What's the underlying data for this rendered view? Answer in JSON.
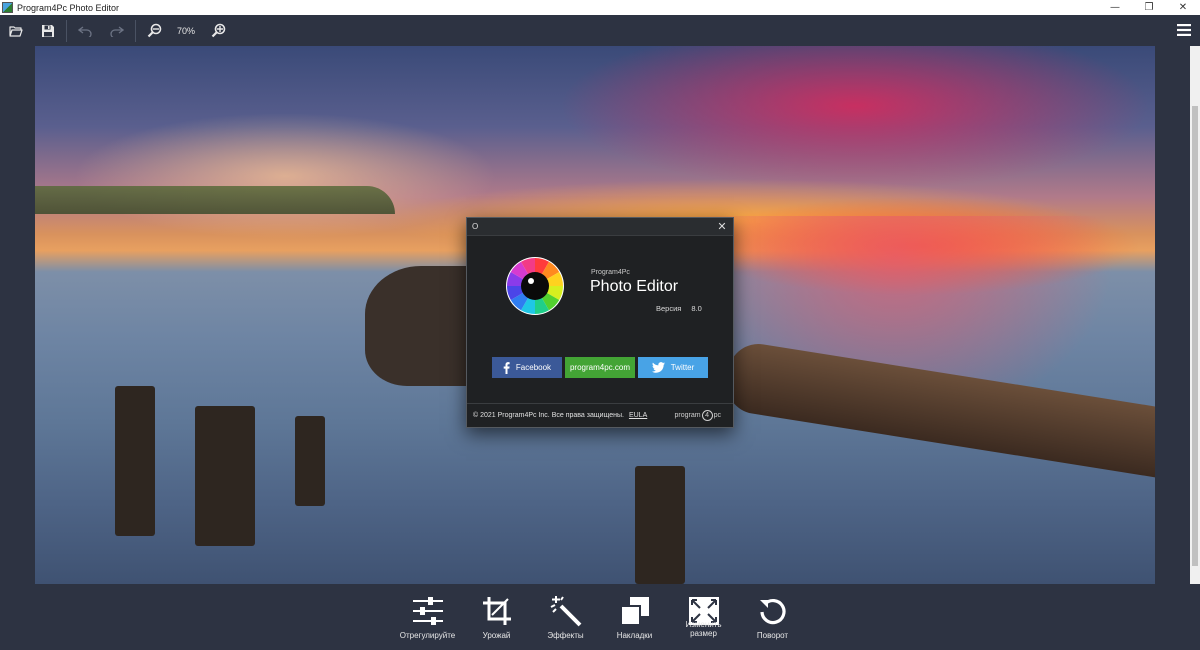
{
  "window": {
    "title": "Program4Pc Photo Editor",
    "minimize": "—",
    "maximize": "❐",
    "close": "✕"
  },
  "toolbar": {
    "zoom": "70%",
    "icons": [
      "folder-open-icon",
      "save-icon",
      "undo-icon",
      "redo-icon",
      "zoom-out-icon",
      "zoom-in-icon",
      "hamburger-menu-icon"
    ]
  },
  "tools": [
    {
      "label": "Отрегулируйте",
      "icon": "sliders-icon"
    },
    {
      "label": "Урожай",
      "icon": "crop-icon"
    },
    {
      "label": "Эффекты",
      "icon": "magic-wand-icon"
    },
    {
      "label": "Накладки",
      "icon": "overlay-icon"
    },
    {
      "label": "Изменить\nразмер",
      "icon": "resize-icon"
    },
    {
      "label": "Поворот",
      "icon": "rotate-icon"
    }
  ],
  "dialog": {
    "title": "О",
    "close": "✕",
    "brand_small": "Program4Pc",
    "brand_big": "Photo Editor",
    "version_label": "Версия",
    "version_value": "8.0",
    "facebook": "Facebook",
    "site": "program4pc.com",
    "twitter": "Twitter",
    "copyright": "© 2021 Program4Pc Inc. Все права защищены.",
    "eula": "EULA",
    "footer_logo_left": "program",
    "footer_logo_digit": "4",
    "footer_logo_right": "pc"
  },
  "colors": {
    "toolbar_bg": "#2d3342",
    "facebook": "#3b5998",
    "site": "#43a435",
    "twitter": "#48a3e6"
  }
}
